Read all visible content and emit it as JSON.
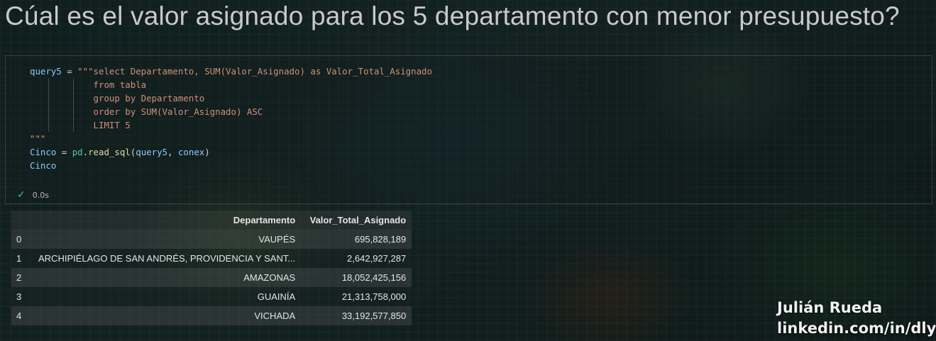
{
  "title": "Cúal es el valor asignado para los 5 departamento con menor presupuesto?",
  "code": {
    "line1_var": "query5",
    "line1_op": " = ",
    "line1_str": "\"\"\"select Departamento, SUM(Valor_Asignado) as Valor_Total_Asignado",
    "line2": "from tabla",
    "line3": "group by Departamento",
    "line4": "order by SUM(Valor_Asignado) ASC",
    "line5": "LIMIT 5",
    "line6": "\"\"\"",
    "line7_var": "Cinco",
    "line7_op": " = ",
    "line7_mod": "pd",
    "line7_dot": ".",
    "line7_fn": "read_sql",
    "line7_args_open": "(",
    "line7_arg1": "query5",
    "line7_sep": ", ",
    "line7_arg2": "conex",
    "line7_args_close": ")",
    "line8": "Cinco"
  },
  "status": {
    "icon": "check-icon",
    "time": "0.0s"
  },
  "table": {
    "columns": [
      "Departamento",
      "Valor_Total_Asignado"
    ],
    "rows": [
      {
        "index": "0",
        "departamento": "VAUPÉS",
        "valor": "695,828,189"
      },
      {
        "index": "1",
        "departamento": "ARCHIPIÉLAGO DE SAN ANDRÉS, PROVIDENCIA Y SANT...",
        "valor": "2,642,927,287"
      },
      {
        "index": "2",
        "departamento": "AMAZONAS",
        "valor": "18,052,425,156"
      },
      {
        "index": "3",
        "departamento": "GUAINÍA",
        "valor": "21,313,758,000"
      },
      {
        "index": "4",
        "departamento": "VICHADA",
        "valor": "33,192,577,850"
      }
    ]
  },
  "watermark": {
    "name": "Julián Rueda",
    "link": "linkedin.com/in/dlyst"
  },
  "colors": {
    "keyword_var": "#8fc8ff",
    "string": "#ce9178",
    "function": "#dcdcaa",
    "check": "#4ec26e"
  }
}
